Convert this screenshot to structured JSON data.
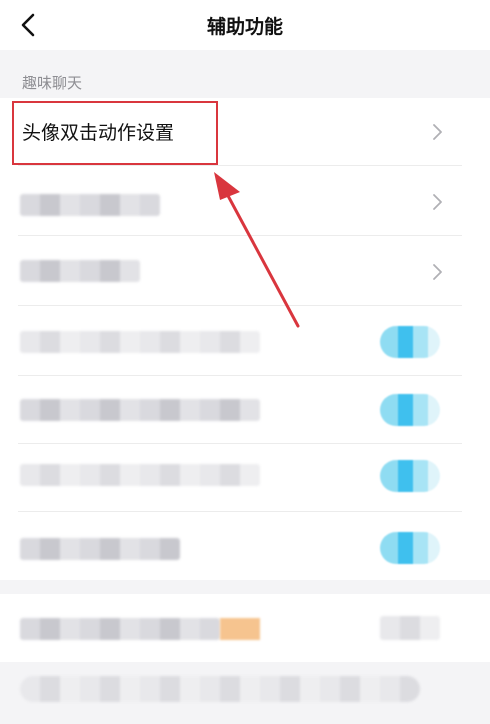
{
  "header": {
    "title": "辅助功能",
    "back_icon": "chevron-left-icon"
  },
  "section": {
    "label": "趣味聊天"
  },
  "rows": [
    {
      "label": "头像双击动作设置",
      "icon": "chevron-right-icon"
    }
  ],
  "colors": {
    "annotation_red": "#d9363e",
    "toggle_blue": "#3fc0ee",
    "section_bg": "#f4f4f6"
  }
}
